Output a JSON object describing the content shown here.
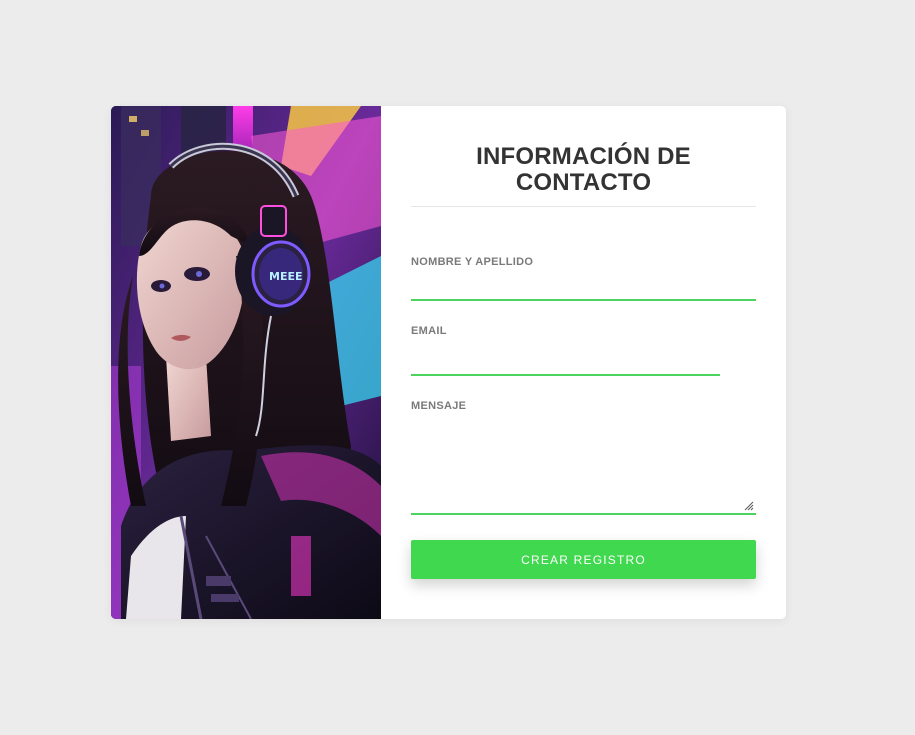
{
  "form": {
    "title": "INFORMACIÓN DE CONTACTO",
    "fields": {
      "name": {
        "label": "NOMBRE Y APELLIDO",
        "value": "",
        "placeholder": ""
      },
      "email": {
        "label": "EMAIL",
        "value": "",
        "placeholder": ""
      },
      "message": {
        "label": "MENSAJE",
        "value": "",
        "placeholder": ""
      }
    },
    "submit_label": "CREAR REGISTRO"
  },
  "image": {
    "subject": "anime-girl-with-headphones",
    "headphone_text": "MEEE"
  },
  "colors": {
    "background": "#ececec",
    "card": "#ffffff",
    "accent": "#40d84f",
    "underline": "#4cd460",
    "title": "#333333",
    "label": "#7a7a7a"
  }
}
